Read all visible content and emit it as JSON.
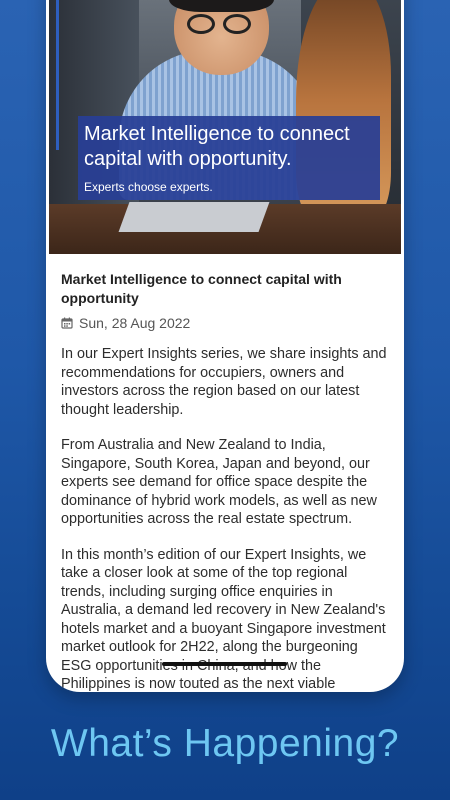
{
  "hero": {
    "banner_title": "Market Intelligence to connect capital with opportunity.",
    "banner_subtitle": "Experts choose experts."
  },
  "article": {
    "title": "Market Intelligence to connect capital with opportunity",
    "date_icon": "calendar-icon",
    "date": "Sun, 28 Aug 2022",
    "paragraphs": [
      "In our Expert Insights series, we share insights and recommendations for occupiers, owners and investors across the region based on our latest thought leadership.",
      "From Australia and New Zealand to India, Singapore, South Korea, Japan and beyond, our experts see demand for office space despite the dominance of hybrid work models, as well as new opportunities across the real estate spectrum.",
      "In this month’s edition of our Expert Insights, we take a closer look at some of the top regional trends, including surging office enquiries in Australia, a demand led recovery in New Zealand's hotels market and a buoyant Singapore investment market outlook for 2H22, along the burgeoning ESG opportunities in China, and how the Philippines is now touted as the next viable"
    ]
  },
  "tagline": "What’s Happening?",
  "colors": {
    "background": "#1f58a8",
    "banner": "#283e96",
    "tagline": "#6ec7f2"
  }
}
